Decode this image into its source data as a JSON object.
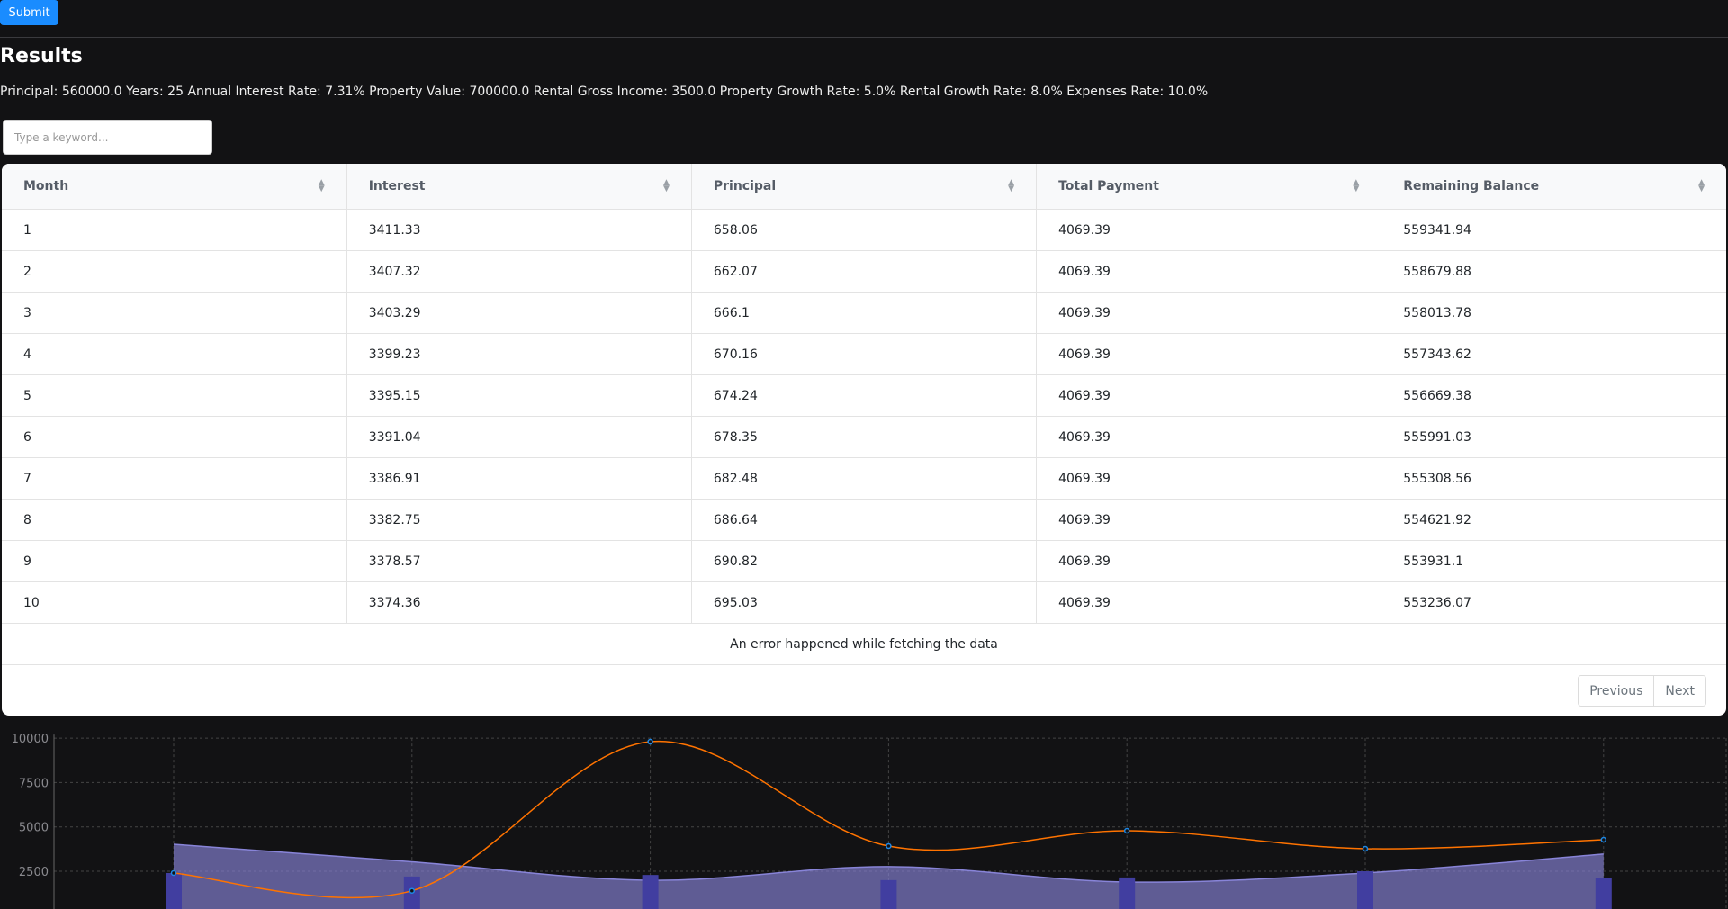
{
  "form": {
    "submit_label": "Submit"
  },
  "results": {
    "title": "Results",
    "summary": "Principal: 560000.0 Years: 25 Annual Interest Rate: 7.31% Property Value: 700000.0 Rental Gross Income: 3500.0 Property Growth Rate: 5.0% Rental Growth Rate: 8.0% Expenses Rate: 10.0%"
  },
  "search": {
    "placeholder": "Type a keyword...",
    "value": ""
  },
  "table": {
    "columns": [
      "Month",
      "Interest",
      "Principal",
      "Total Payment",
      "Remaining Balance"
    ],
    "rows": [
      [
        "1",
        "3411.33",
        "658.06",
        "4069.39",
        "559341.94"
      ],
      [
        "2",
        "3407.32",
        "662.07",
        "4069.39",
        "558679.88"
      ],
      [
        "3",
        "3403.29",
        "666.1",
        "4069.39",
        "558013.78"
      ],
      [
        "4",
        "3399.23",
        "670.16",
        "4069.39",
        "557343.62"
      ],
      [
        "5",
        "3395.15",
        "674.24",
        "4069.39",
        "556669.38"
      ],
      [
        "6",
        "3391.04",
        "678.35",
        "4069.39",
        "555991.03"
      ],
      [
        "7",
        "3386.91",
        "682.48",
        "4069.39",
        "555308.56"
      ],
      [
        "8",
        "3382.75",
        "686.64",
        "4069.39",
        "554621.92"
      ],
      [
        "9",
        "3378.57",
        "690.82",
        "4069.39",
        "553931.1"
      ],
      [
        "10",
        "3374.36",
        "695.03",
        "4069.39",
        "553236.07"
      ]
    ],
    "error_message": "An error happened while fetching the data",
    "pagination": {
      "previous_label": "Previous",
      "next_label": "Next"
    }
  },
  "chart_data": {
    "type": "composed",
    "ylim": [
      0,
      10000
    ],
    "yticks": [
      "10000",
      "7500",
      "5000",
      "2500"
    ],
    "grid": true,
    "categories_count": 7,
    "series": [
      {
        "kind": "area",
        "color": "#8884d8",
        "values": [
          4020,
          3030,
          1990,
          2760,
          1890,
          2400,
          3470
        ]
      },
      {
        "kind": "bar",
        "color": "#413ea0",
        "values": [
          2400,
          2200,
          2290,
          2000,
          2150,
          2500,
          2100
        ]
      },
      {
        "kind": "line",
        "color": "#ff7300",
        "values": [
          2400,
          1400,
          9800,
          3920,
          4780,
          3770,
          4275
        ]
      }
    ]
  }
}
